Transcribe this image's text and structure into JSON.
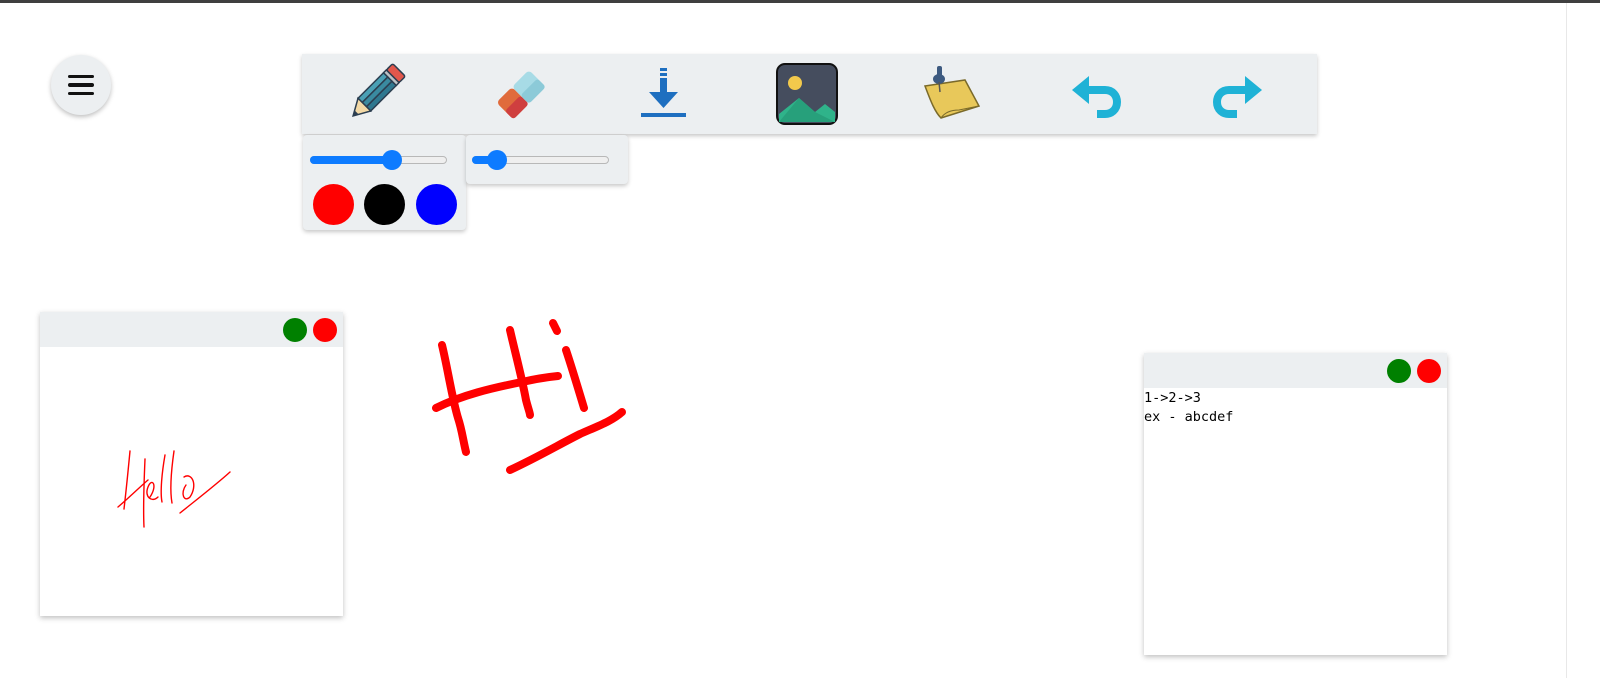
{
  "menu": {
    "icon": "hamburger-icon"
  },
  "toolbar": {
    "tools": [
      {
        "name": "pencil",
        "icon": "pencil-icon"
      },
      {
        "name": "eraser",
        "icon": "eraser-icon"
      },
      {
        "name": "download",
        "icon": "download-icon"
      },
      {
        "name": "image",
        "icon": "image-icon"
      },
      {
        "name": "sticky-note",
        "icon": "sticky-note-icon"
      },
      {
        "name": "undo",
        "icon": "undo-icon"
      },
      {
        "name": "redo",
        "icon": "redo-icon"
      }
    ]
  },
  "pencil_options": {
    "size_level": 0.6,
    "colors": [
      "#ff0000",
      "#000000",
      "#0000ff"
    ]
  },
  "eraser_options": {
    "size_level": 0.18
  },
  "sticky_notes": [
    {
      "type": "drawing",
      "handwriting": "Hello",
      "buttons": {
        "minimize_color": "#008000",
        "close_color": "#ff0000"
      }
    },
    {
      "type": "text",
      "text": "1->2->3\nex - abcdef",
      "buttons": {
        "minimize_color": "#008000",
        "close_color": "#ff0000"
      }
    }
  ],
  "canvas": {
    "drawing": "Hi",
    "stroke_color": "#ff0000"
  },
  "colors": {
    "toolbar_bg": "#eceff1",
    "accent": "#0d7bff",
    "topbar": "#3f3f3f"
  }
}
